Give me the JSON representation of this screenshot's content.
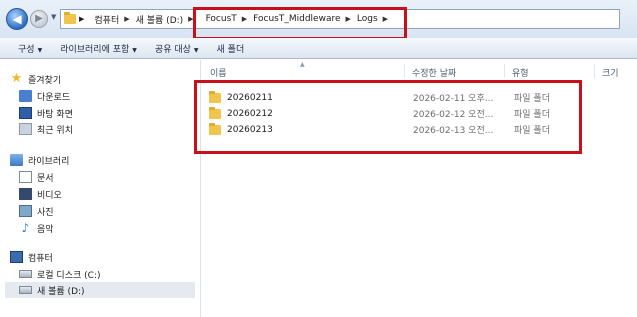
{
  "window": {
    "address_path": [
      {
        "label": "컴퓨터"
      },
      {
        "label": "새 볼륨 (D:)"
      },
      {
        "label": "FocusT"
      },
      {
        "label": "FocusT_Middleware"
      },
      {
        "label": "Logs"
      }
    ]
  },
  "toolbar": {
    "organize": "구성",
    "include_in_library": "라이브러리에 포함",
    "share_with": "공유 대상",
    "new_folder": "새 폴더"
  },
  "sidebar": {
    "favorites": {
      "label": "즐겨찾기",
      "items": [
        {
          "label": "다운로드",
          "icon": "download-folder-icon"
        },
        {
          "label": "바탕 화면",
          "icon": "desktop-icon"
        },
        {
          "label": "최근 위치",
          "icon": "recent-places-icon"
        }
      ]
    },
    "libraries": {
      "label": "라이브러리",
      "items": [
        {
          "label": "문서",
          "icon": "documents-icon"
        },
        {
          "label": "비디오",
          "icon": "videos-icon"
        },
        {
          "label": "사진",
          "icon": "pictures-icon"
        },
        {
          "label": "음악",
          "icon": "music-icon"
        }
      ]
    },
    "computer": {
      "label": "컴퓨터",
      "items": [
        {
          "label": "로컬 디스크 (C:)",
          "icon": "local-disk-icon"
        },
        {
          "label": "새 볼륨 (D:)",
          "icon": "drive-icon",
          "selected": true
        }
      ]
    }
  },
  "columns": {
    "name": "이름",
    "date_modified": "수정한 날짜",
    "type": "유형",
    "size": "크기"
  },
  "files": [
    {
      "name": "20260211",
      "date": "2026-02-11 오후...",
      "type": "파일 폴더"
    },
    {
      "name": "20260212",
      "date": "2026-02-12 오전...",
      "type": "파일 폴더"
    },
    {
      "name": "20260213",
      "date": "2026-02-13 오전...",
      "type": "파일 폴더"
    }
  ],
  "colors": {
    "highlight_box": "#c8101b",
    "folder": "#f1c54c",
    "toolbar_bg": "#dde6f1"
  }
}
